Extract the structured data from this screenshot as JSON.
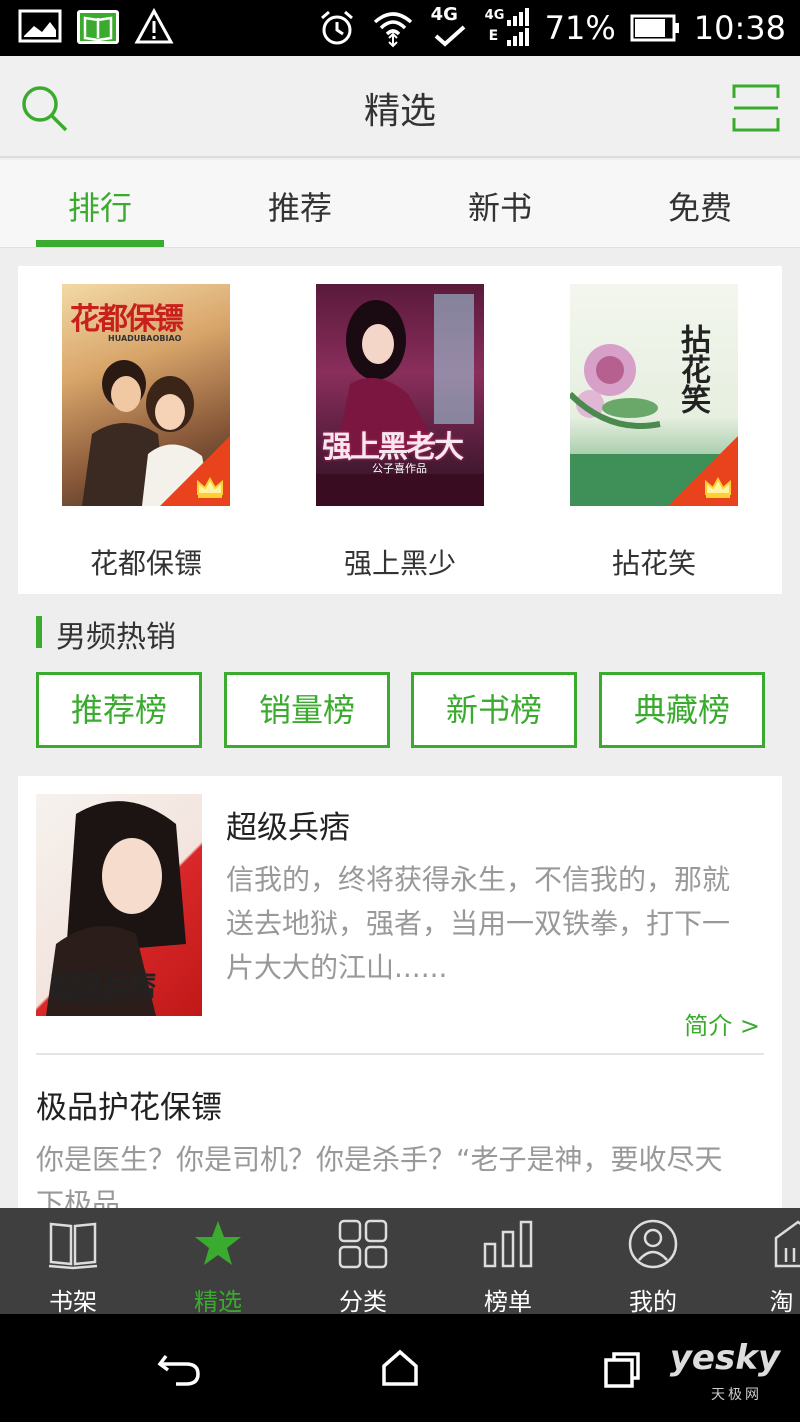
{
  "status": {
    "network": "4G",
    "network_small": "4G",
    "network_e": "E",
    "battery": "71%",
    "time": "10:38"
  },
  "header": {
    "title": "精选"
  },
  "tabs": [
    {
      "label": "排行",
      "active": true
    },
    {
      "label": "推荐",
      "active": false
    },
    {
      "label": "新书",
      "active": false
    },
    {
      "label": "免费",
      "active": false
    }
  ],
  "top_books": [
    {
      "title": "花都保镖",
      "cover_text": "花都保镖",
      "cover_sub": "HUADUBAOBIAO"
    },
    {
      "title": "强上黑少",
      "cover_text": "强上黑老大",
      "cover_sub": "公子喜作品"
    },
    {
      "title": "拈花笑",
      "cover_text": "拈花笑",
      "cover_sub": ""
    }
  ],
  "section": {
    "title": "男频热销"
  },
  "rank_buttons": [
    "推荐榜",
    "销量榜",
    "新书榜",
    "典藏榜"
  ],
  "list": [
    {
      "title": "超级兵痞",
      "desc": "信我的，终将获得永生，不信我的，那就送去地狱，强者，当用一双铁拳，打下一片大大的江山......",
      "desc_lines": [
        "信我的，终将获得永生，不信我的，那就",
        "送去地狱，强者，当用一双铁拳，打下一",
        "片大大的江山......"
      ],
      "cover_text": "超级兵痞",
      "cover_sub": "CHAOJIB INPI",
      "link": "简介 >"
    },
    {
      "title": "极品护花保镖",
      "desc_lines": [
        "你是医生？你是司机？你是杀手？“老子是神，要收尽天",
        "下极品"
      ]
    }
  ],
  "bottom_nav": [
    {
      "label": "书架",
      "icon": "book-icon",
      "active": false
    },
    {
      "label": "精选",
      "icon": "star-icon",
      "active": true
    },
    {
      "label": "分类",
      "icon": "grid-icon",
      "active": false
    },
    {
      "label": "榜单",
      "icon": "bar-chart-icon",
      "active": false
    },
    {
      "label": "我的",
      "icon": "user-icon",
      "active": false
    },
    {
      "label": "淘",
      "icon": "shop-icon",
      "active": false
    }
  ],
  "watermark": {
    "text": "yesky",
    "sub": "天极网"
  },
  "colors": {
    "accent": "#3aab2e",
    "nav_bg": "#3f3f3f",
    "badge": "#e8431c"
  }
}
